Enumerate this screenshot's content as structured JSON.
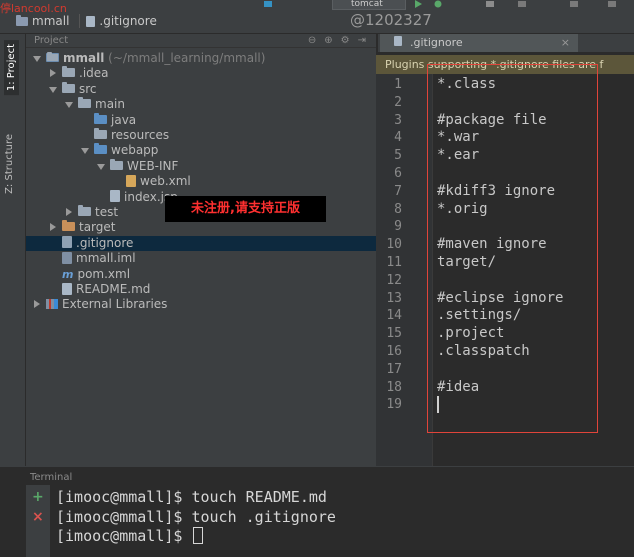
{
  "watermark": "停lancool.cn",
  "user_tag": "@1202327",
  "toolbar": {
    "breadcrumb": [
      "mmall",
      ".gitignore"
    ],
    "run_config": "tomcat"
  },
  "left_strip": {
    "project_tab": "1: Project",
    "structure_tab": "Z: Structure"
  },
  "project_panel": {
    "header_label": "Project",
    "rows": [
      {
        "name": "mmall",
        "suffix": " (~/mmall_learning/mmall)",
        "icon": "module-folder-icon",
        "arrow": "down",
        "indent": 0
      },
      {
        "name": ".idea",
        "icon": "folder-icon",
        "arrow": "right",
        "indent": 1
      },
      {
        "name": "src",
        "icon": "folder-icon",
        "arrow": "down",
        "indent": 1
      },
      {
        "name": "main",
        "icon": "folder-icon",
        "arrow": "down",
        "indent": 2
      },
      {
        "name": "java",
        "icon": "source-folder-icon",
        "arrow": "",
        "indent": 3
      },
      {
        "name": "resources",
        "icon": "resources-folder-icon",
        "arrow": "",
        "indent": 3
      },
      {
        "name": "webapp",
        "icon": "web-folder-icon",
        "arrow": "down",
        "indent": 3
      },
      {
        "name": "WEB-INF",
        "icon": "folder-icon",
        "arrow": "down",
        "indent": 4
      },
      {
        "name": "web.xml",
        "icon": "xml-file-icon",
        "arrow": "",
        "indent": 5
      },
      {
        "name": "index.jsp",
        "icon": "jsp-file-icon",
        "arrow": "",
        "indent": 4
      },
      {
        "name": "test",
        "icon": "folder-icon",
        "arrow": "right",
        "indent": 2
      },
      {
        "name": "target",
        "icon": "excluded-folder-icon",
        "arrow": "right",
        "indent": 1
      },
      {
        "name": ".gitignore",
        "icon": "gitignore-file-icon",
        "arrow": "",
        "indent": 1,
        "selected": true
      },
      {
        "name": "mmall.iml",
        "icon": "iml-file-icon",
        "arrow": "",
        "indent": 1
      },
      {
        "name": "pom.xml",
        "icon": "maven-file-icon",
        "arrow": "",
        "indent": 1
      },
      {
        "name": "README.md",
        "icon": "md-file-icon",
        "arrow": "",
        "indent": 1
      },
      {
        "name": "External Libraries",
        "icon": "libraries-icon",
        "arrow": "right",
        "indent": 0
      }
    ]
  },
  "banner": "未注册,请支持正版",
  "editor": {
    "tab_label": ".gitignore",
    "notice": "Plugins supporting *.gitignore files are f",
    "lines": [
      "*.class",
      "",
      "#package file",
      "*.war",
      "*.ear",
      "",
      "#kdiff3 ignore",
      "*.orig",
      "",
      "#maven ignore",
      "target/",
      "",
      "#eclipse ignore",
      ".settings/",
      ".project",
      ".classpatch",
      "",
      "#idea",
      ""
    ]
  },
  "terminal": {
    "title": "Terminal",
    "lines": [
      "[imooc@mmall]$ touch README.md",
      "[imooc@mmall]$ touch .gitignore",
      "[imooc@mmall]$ "
    ]
  }
}
